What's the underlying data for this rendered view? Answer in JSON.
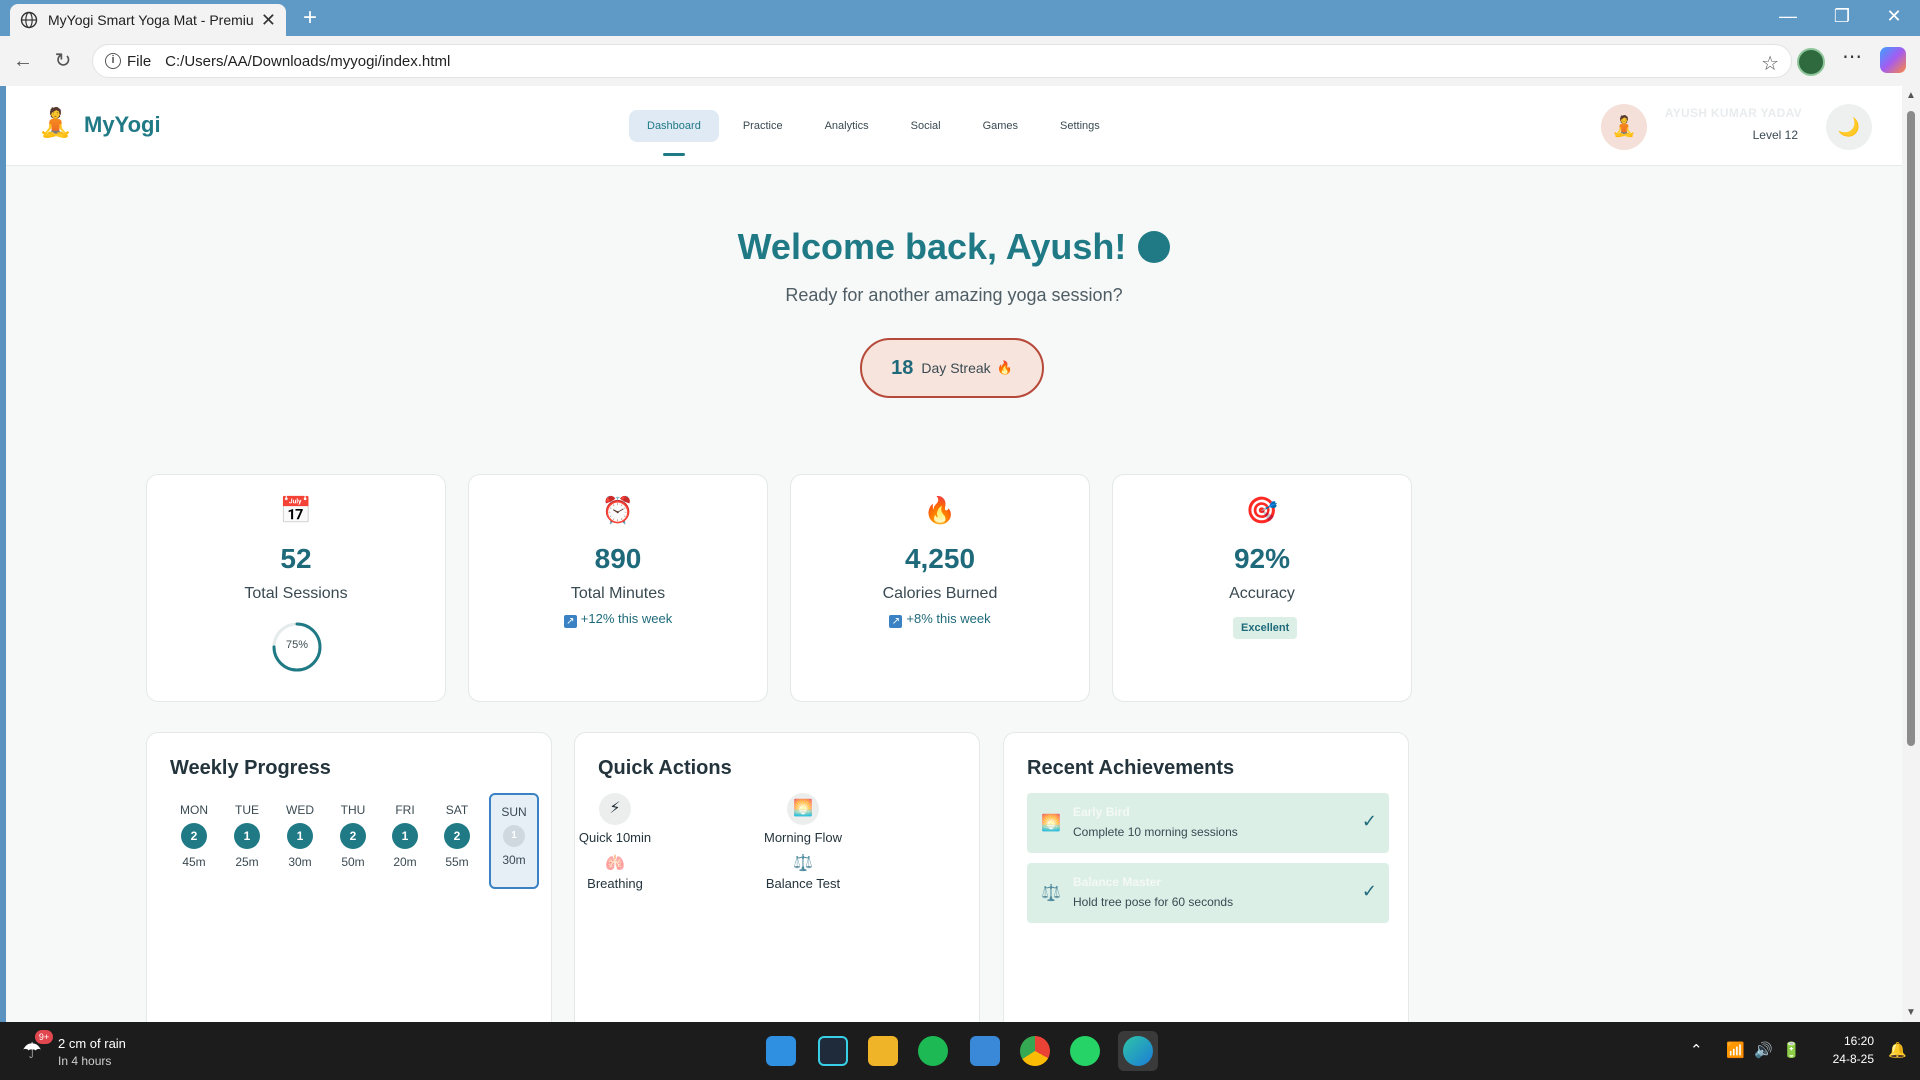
{
  "browser": {
    "tab_title": "MyYogi Smart Yoga Mat - Premium",
    "new_tab_icon": "plus-icon",
    "address_prefix": "File",
    "url": "C:/Users/AA/Downloads/myyogi/index.html"
  },
  "app": {
    "logo_text": "MyYogi",
    "nav": [
      "Dashboard",
      "Practice",
      "Analytics",
      "Social",
      "Games",
      "Settings"
    ],
    "active_nav": "Dashboard",
    "user_name": "AYUSH KUMAR YADAV",
    "user_level": "Level 12",
    "theme_icon": "moon-icon"
  },
  "hero": {
    "welcome": "Welcome back, Ayush!",
    "subtitle": "Ready for another amazing yoga session?",
    "streak_number": "18",
    "streak_label": "Day Streak"
  },
  "stats": {
    "sessions": {
      "value": "52",
      "label": "Total Sessions",
      "progress_text": "75%",
      "progress": 0.75
    },
    "minutes": {
      "value": "890",
      "label": "Total Minutes",
      "trend": "+12% this week"
    },
    "calories": {
      "value": "4,250",
      "label": "Calories Burned",
      "trend": "+8% this week"
    },
    "accuracy": {
      "value": "92%",
      "label": "Accuracy",
      "badge": "Excellent"
    }
  },
  "weekly": {
    "title": "Weekly Progress",
    "days": [
      {
        "name": "MON",
        "count": "2",
        "mins": "45m"
      },
      {
        "name": "TUE",
        "count": "1",
        "mins": "25m"
      },
      {
        "name": "WED",
        "count": "1",
        "mins": "30m"
      },
      {
        "name": "THU",
        "count": "2",
        "mins": "50m"
      },
      {
        "name": "FRI",
        "count": "1",
        "mins": "20m"
      },
      {
        "name": "SAT",
        "count": "2",
        "mins": "55m"
      },
      {
        "name": "SUN",
        "count": "1",
        "mins": "30m"
      }
    ]
  },
  "quick_actions": {
    "title": "Quick Actions",
    "items": [
      "Quick 10min",
      "Morning Flow",
      "Breathing",
      "Balance Test"
    ]
  },
  "achievements": {
    "title": "Recent Achievements",
    "items": [
      {
        "name": "Early Bird",
        "desc": "Complete 10 morning sessions"
      },
      {
        "name": "Balance Master",
        "desc": "Hold tree pose for 60 seconds"
      }
    ]
  },
  "taskbar": {
    "weather_main": "2 cm of rain",
    "weather_sub": "In 4 hours",
    "notification_count": "9+",
    "time": "16:20",
    "date": "24-8-25"
  }
}
